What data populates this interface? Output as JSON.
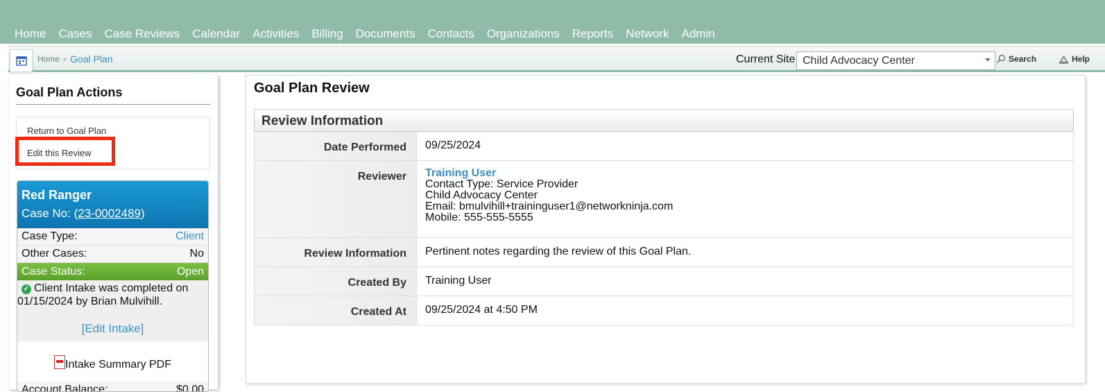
{
  "nav": {
    "items": [
      "Home",
      "Cases",
      "Case Reviews",
      "Calendar",
      "Activities",
      "Billing",
      "Documents",
      "Contacts",
      "Organizations",
      "Reports",
      "Network",
      "Admin"
    ]
  },
  "breadcrumb": {
    "home": "Home",
    "current": "Goal Plan"
  },
  "site": {
    "label": "Current Site",
    "selected": "Child Advocacy Center"
  },
  "tools": {
    "search": "Search",
    "help": "Help"
  },
  "sidebar": {
    "title": "Goal Plan Actions",
    "actions": {
      "return": "Return to Goal Plan",
      "edit": "Edit this Review"
    },
    "case": {
      "name": "Red Ranger",
      "case_no_prefix": "Case No: (",
      "case_no": "23-0002489",
      "case_no_suffix": ")",
      "case_type_label": "Case Type:",
      "case_type_value": "Client",
      "other_cases_label": "Other Cases:",
      "other_cases_value": "No",
      "status_label": "Case Status:",
      "status_value": "Open",
      "intake_text": "Client Intake was completed on 01/15/2024 by Brian Mulvihill.",
      "edit_intake": "[Edit Intake]",
      "pdf_label": "Intake Summary PDF",
      "balance_label": "Account Balance:",
      "balance_value": "$0.00"
    }
  },
  "main": {
    "title": "Goal Plan Review",
    "section_title": "Review Information",
    "fields": {
      "date_label": "Date Performed",
      "date_value": "09/25/2024",
      "reviewer_label": "Reviewer",
      "reviewer_name": "Training User",
      "reviewer_contact_type": "Contact Type: Service Provider",
      "reviewer_org": "Child Advocacy Center",
      "reviewer_email": "Email: bmulvihill+traininguser1@networkninja.com",
      "reviewer_mobile": "Mobile: 555-555-5555",
      "info_label": "Review Information",
      "info_value": "Pertinent notes regarding the review of this Goal Plan.",
      "created_by_label": "Created By",
      "created_by_value": "Training User",
      "created_at_label": "Created At",
      "created_at_value": "09/25/2024 at 4:50 PM"
    }
  },
  "colors": {
    "nav_bg": "#8fbba8",
    "link": "#3a8fc2",
    "highlight": "#f22c14",
    "status_green": "#5aa12c",
    "case_blue": "#0d75b0"
  }
}
